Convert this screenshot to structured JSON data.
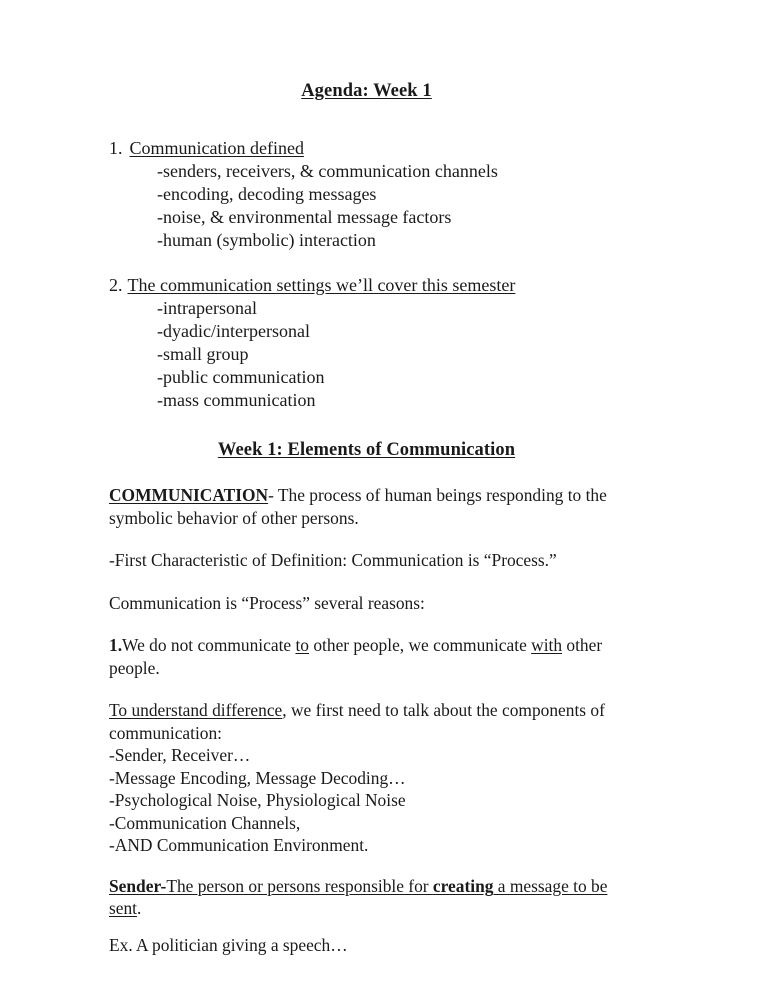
{
  "document": {
    "title": "Agenda: Week 1",
    "section_heading": "Week 1: Elements of Communication"
  },
  "agenda": {
    "items": [
      {
        "number": "1.",
        "heading": "Communication defined",
        "number_underlined": false,
        "sub_items": [
          "-senders, receivers, & communication channels",
          "-encoding, decoding messages",
          "-noise, & environmental message factors",
          "-human (symbolic) interaction"
        ]
      },
      {
        "number": "2.",
        "heading": "The communication settings we’ll cover this semester",
        "number_underlined": false,
        "sub_items": [
          "-intrapersonal",
          "-dyadic/interpersonal",
          "-small group",
          "-public communication",
          "-mass communication"
        ]
      }
    ]
  },
  "body": {
    "definition": {
      "term": "COMMUNICATION",
      "rest": "- The process of human beings responding to the symbolic behavior of other persons."
    },
    "first_characteristic": "-First Characteristic of Definition: Communication is “Process.”",
    "process_reasons_intro": "Communication is “Process” several reasons:",
    "reason_one": {
      "number": "1.",
      "part1": "We do not communicate ",
      "emph1": "to",
      "part2": " other people, we communicate ",
      "emph2": "with",
      "part3": " other people."
    },
    "components": {
      "lead_underlined": "To understand difference",
      "lead_rest": ", we first need to talk about the components of communication:",
      "lines": [
        "-Sender, Receiver…",
        "-Message Encoding, Message Decoding…",
        "-Psychological Noise, Physiological Noise",
        "-Communication Channels,",
        "-AND Communication Environment."
      ]
    },
    "sender": {
      "term": "Sender-",
      "part1": "The person or persons responsible for ",
      "emph": "creating",
      "part2": " a message to be sent",
      "trailing": "."
    },
    "example": "Ex. A politician giving a speech…"
  }
}
